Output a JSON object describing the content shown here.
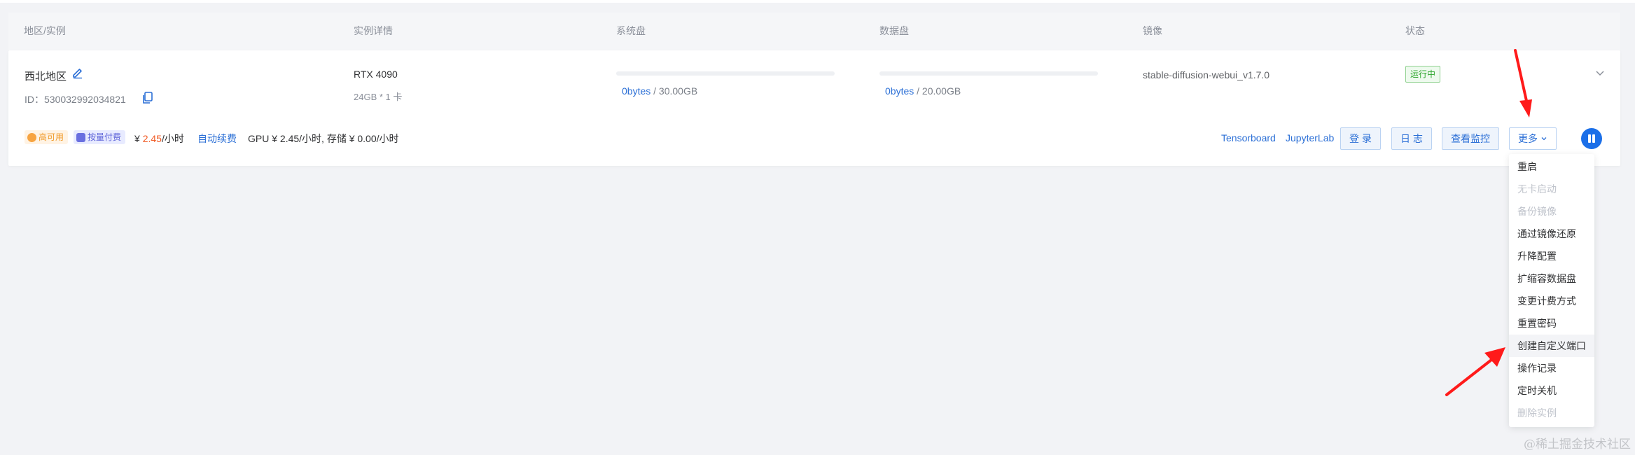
{
  "columns": {
    "region": "地区/实例",
    "detail": "实例详情",
    "system_disk": "系统盘",
    "data_disk": "数据盘",
    "image": "镜像",
    "status": "状态"
  },
  "instance": {
    "region": "西北地区",
    "id_text": "ID：530032992034821",
    "gpu_name": "RTX 4090",
    "gpu_spec": "24GB * 1 卡",
    "system_disk": {
      "used": "0bytes",
      "total": " / 30.00GB",
      "usage_percent": 0
    },
    "data_disk": {
      "used": "0bytes",
      "total": " / 20.00GB",
      "usage_percent": 0
    },
    "image_name": "stable-diffusion-webui_v1.7.0",
    "status": "运行中"
  },
  "billing": {
    "tag_ha": "高可用",
    "tag_pay": "按量付费",
    "price_prefix": "¥ ",
    "price_value": "2.45",
    "price_unit": "/小时",
    "auto_renew": "自动续费",
    "pricing_detail": "GPU ¥ 2.45/小时, 存储 ¥ 0.00/小时"
  },
  "actions": {
    "tensorboard": "Tensorboard",
    "jupyterlab": "JupyterLab",
    "login": "登 录",
    "logs": "日 志",
    "monitor": "查看监控",
    "more": "更多"
  },
  "menu": [
    {
      "label": "重启",
      "disabled": false
    },
    {
      "label": "无卡启动",
      "disabled": true
    },
    {
      "label": "备份镜像",
      "disabled": true
    },
    {
      "label": "通过镜像还原",
      "disabled": false
    },
    {
      "label": "升降配置",
      "disabled": false
    },
    {
      "label": "扩缩容数据盘",
      "disabled": false
    },
    {
      "label": "变更计费方式",
      "disabled": false
    },
    {
      "label": "重置密码",
      "disabled": false
    },
    {
      "label": "创建自定义端口",
      "disabled": false,
      "hovered": true
    },
    {
      "label": "操作记录",
      "disabled": false
    },
    {
      "label": "定时关机",
      "disabled": false
    },
    {
      "label": "删除实例",
      "disabled": true
    }
  ],
  "watermark": "@稀土掘金技术社区",
  "colors": {
    "accent": "#2b6fd6",
    "status_green": "#2ba52b",
    "price_orange": "#f05a24",
    "annotation_red": "#ff1a1a"
  },
  "icons": [
    "edit-icon",
    "copy-icon",
    "chevron-down-icon",
    "pause-icon"
  ]
}
